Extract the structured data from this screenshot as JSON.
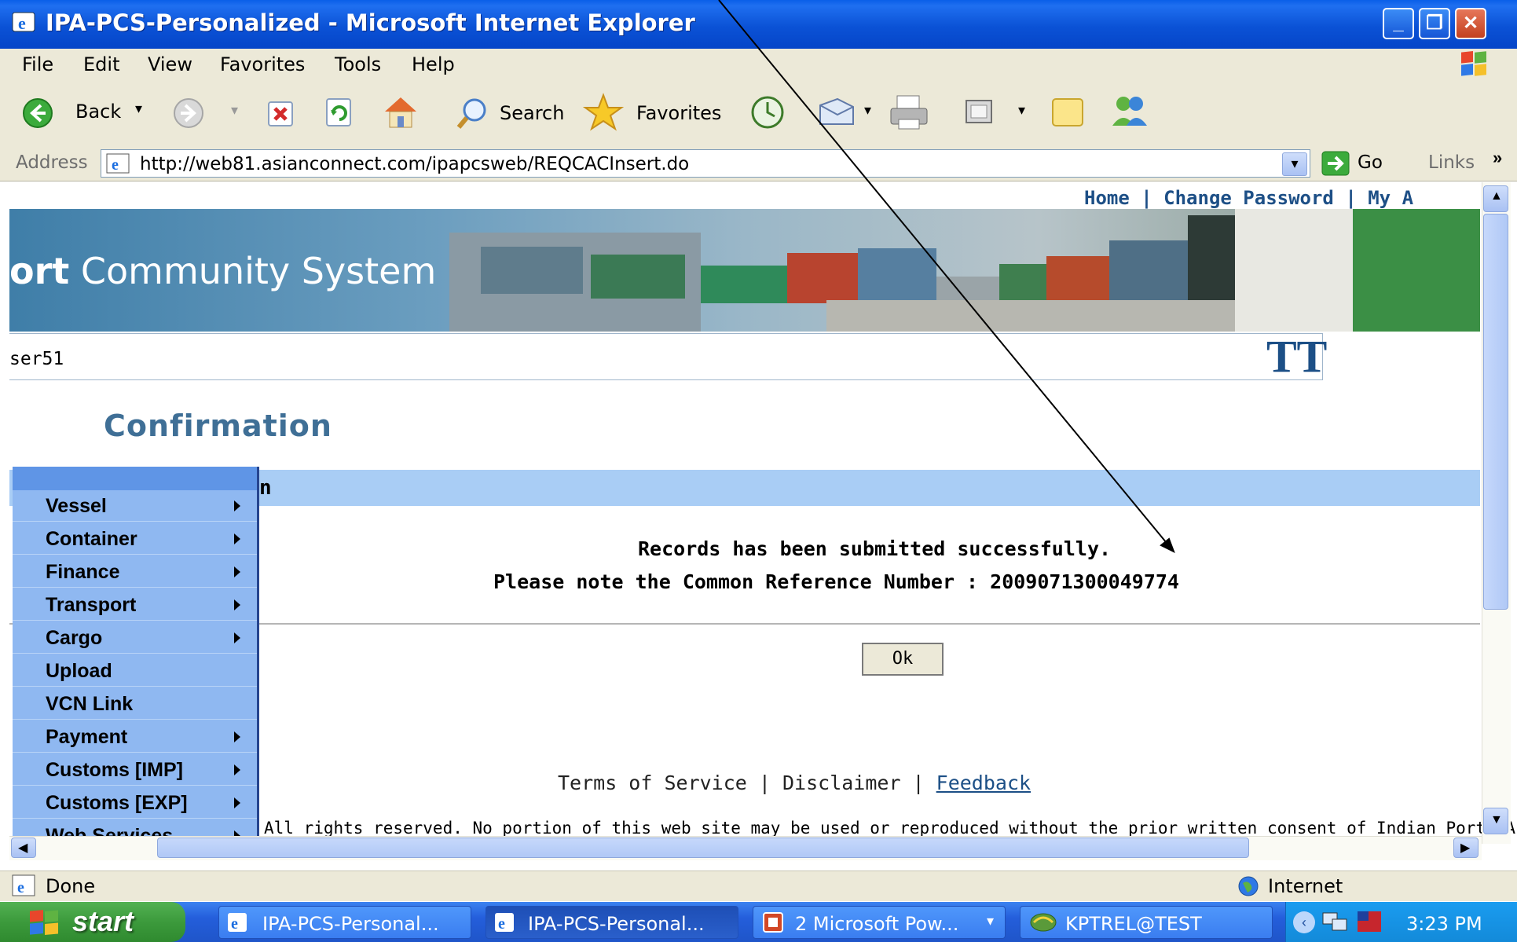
{
  "window": {
    "title": "IPA-PCS-Personalized - Microsoft Internet Explorer"
  },
  "menubar": {
    "items": [
      "File",
      "Edit",
      "View",
      "Favorites",
      "Tools",
      "Help"
    ]
  },
  "toolbar": {
    "back_label": "Back",
    "search_label": "Search",
    "favorites_label": "Favorites"
  },
  "addressbar": {
    "label": "Address",
    "url": "http://web81.asianconnect.com/ipapcsweb/REQCACInsert.do",
    "go_label": "Go",
    "links_label": "Links"
  },
  "page": {
    "top_links": "Home | Change Password | My A",
    "banner_bold": "ort",
    "banner_rest": " Community System",
    "user": "ser51",
    "logo_text": "TT",
    "title": "Confirmation",
    "section_fragment": "n",
    "message_line1": "Records has been submitted successfully.",
    "message_line2": "Please note the Common Reference Number : 2009071300049774",
    "ok_label": "Ok",
    "footer_terms": "Terms of Service",
    "footer_disclaimer": "Disclaimer",
    "footer_feedback": "Feedback",
    "footer_sep": " | ",
    "copyright": "All rights reserved. No portion of this web site may be used or reproduced without the prior written consent of Indian Ports Assoc"
  },
  "left_menu": {
    "items": [
      {
        "label": "Vessel"
      },
      {
        "label": "Container"
      },
      {
        "label": "Finance"
      },
      {
        "label": "Transport"
      },
      {
        "label": "Cargo"
      },
      {
        "label": "Upload"
      },
      {
        "label": "VCN Link"
      },
      {
        "label": "Payment"
      },
      {
        "label": "Customs [IMP]"
      },
      {
        "label": "Customs [EXP]"
      },
      {
        "label": "Web Services"
      }
    ]
  },
  "statusbar": {
    "status": "Done",
    "zone": "Internet"
  },
  "taskbar": {
    "start_label": "start",
    "tasks": [
      {
        "label": "IPA-PCS-Personal..."
      },
      {
        "label": "IPA-PCS-Personal..."
      },
      {
        "label": "2 Microsoft Pow..."
      },
      {
        "label": "KPTREL@TEST"
      }
    ],
    "clock": "3:23 PM"
  }
}
